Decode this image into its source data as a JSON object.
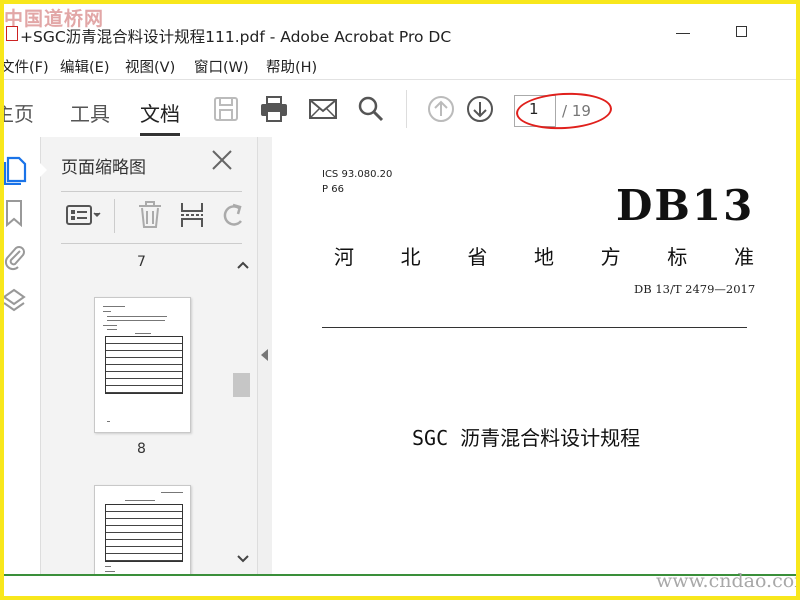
{
  "window": {
    "watermark_top": "中国道桥网",
    "title": "+SGC沥青混合料设计规程111.pdf - Adobe Acrobat Pro DC"
  },
  "menu": {
    "items": [
      "文件(F)",
      "编辑(E)",
      "视图(V)",
      "窗口(W)",
      "帮助(H)"
    ]
  },
  "toolbar": {
    "tabs": [
      {
        "label": "主页",
        "active": false
      },
      {
        "label": "工具",
        "active": false
      },
      {
        "label": "文档",
        "active": true
      }
    ],
    "icons": [
      "save-icon",
      "print-icon",
      "email-icon",
      "search-icon",
      "page-up-icon",
      "page-down-icon"
    ],
    "page_number": "1",
    "page_total": "/ 19"
  },
  "sidebar_icons": [
    "page-thumbnails-icon",
    "bookmark-icon",
    "attachment-icon",
    "layers-icon"
  ],
  "thumbnail_panel": {
    "title": "页面缩略图",
    "tools": [
      "options-icon",
      "delete-icon",
      "insert-icon",
      "rotate-icon"
    ],
    "pages": [
      {
        "label": "7"
      },
      {
        "label": "8"
      }
    ]
  },
  "document": {
    "ics_line": "ICS 93.080.20",
    "p_line": "P 66",
    "standard_code": "DB13",
    "province_chars": [
      "河",
      "北",
      "省",
      "地",
      "方",
      "标",
      "准"
    ],
    "standard_number": "DB 13/T 2479—2017",
    "subject": "SGC 沥青混合料设计规程"
  },
  "watermark_bottom": "www.cndao.com",
  "colors": {
    "frame": "#f8e71c",
    "highlight_ring": "#e0201c",
    "bottom_line": "#3a8f3a"
  }
}
